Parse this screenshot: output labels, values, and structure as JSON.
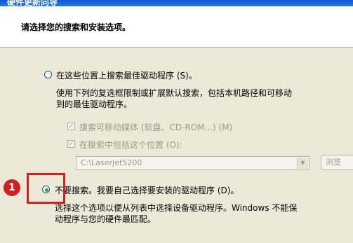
{
  "window": {
    "title": "硬件更新向导"
  },
  "header": {
    "instruction": "请选择您的搜索和安装选项。"
  },
  "option_search": {
    "label": "在这些位置上搜索最佳驱动程序 (S)。",
    "selected": false,
    "description_line1": "使用下列的复选框限制或扩展默认搜索，包括本机路径和可移动",
    "description_line2": "到的最佳驱动程序。"
  },
  "checkbox_removable": {
    "label": "搜索可移动媒体 (软盘、CD-ROM...) (M)",
    "checked": true,
    "enabled": false
  },
  "checkbox_location": {
    "label": "在搜索中包括这个位置 (O):",
    "checked": true,
    "enabled": false
  },
  "location_combo": {
    "value": "C:\\LaserJet5200",
    "enabled": false
  },
  "browse_button": {
    "label": "浏览"
  },
  "option_manual": {
    "label": "不要搜索。我要自己选择要安装的驱动程序 (D)。",
    "selected": true,
    "description_line1": "选择这个选项以便从列表中选择设备驱动程序。Windows 不能保",
    "description_line2": "动程序与您的硬件最匹配。"
  },
  "annotation": {
    "step_number": "1",
    "color": "#d21f1f"
  },
  "colors": {
    "radio_dot": "#23a01f",
    "titlebar": "#0a59d8"
  }
}
